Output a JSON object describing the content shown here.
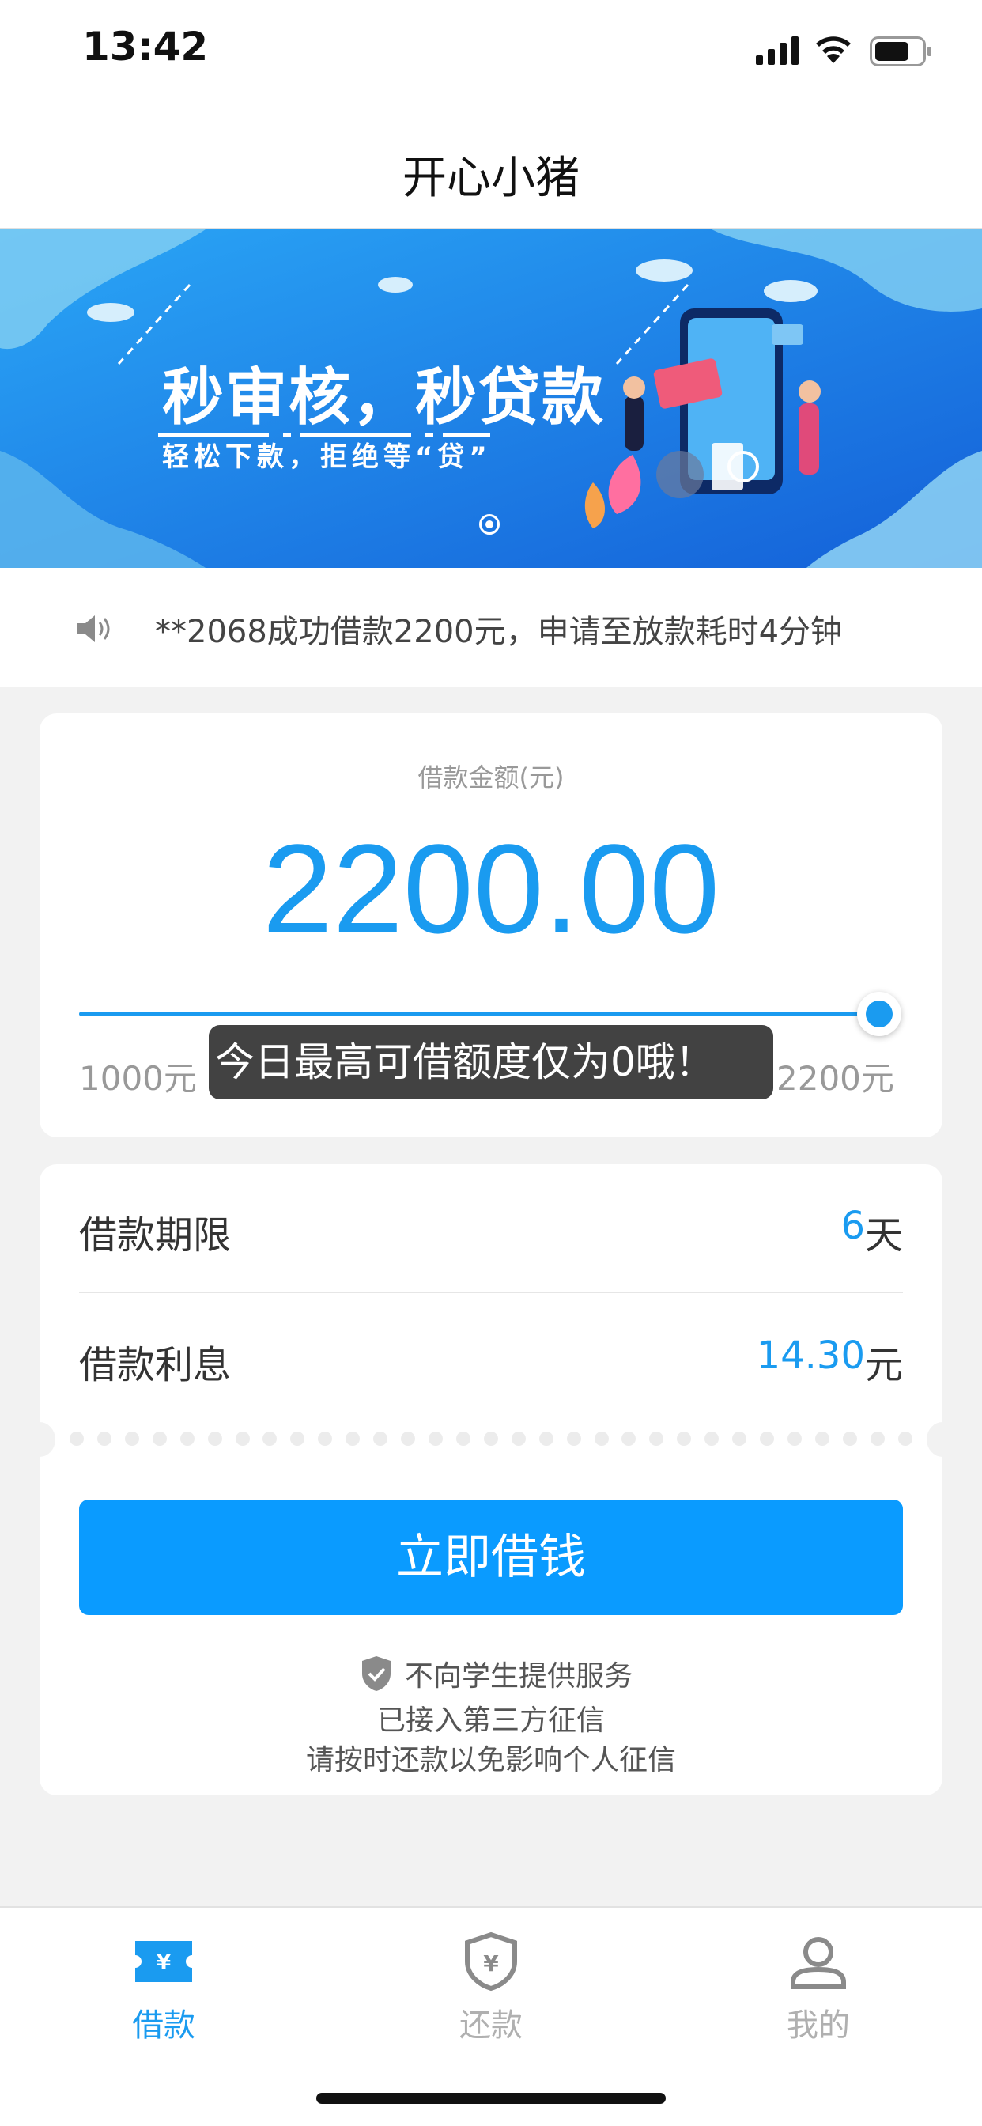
{
  "status_bar": {
    "time": "13:42",
    "icons": [
      "signal-icon",
      "wifi-icon",
      "battery-icon"
    ]
  },
  "nav": {
    "title": "开心小猪"
  },
  "banner": {
    "headline": "秒审核，秒贷款",
    "subline": "轻松下款，拒绝等“贷”",
    "page_indicator_count": 1,
    "background_color": "#1f8fee"
  },
  "notice": {
    "icon": "speaker-icon",
    "text": "**2068成功借款2200元，申请至放款耗时4分钟"
  },
  "amount_card": {
    "label": "借款金额(元)",
    "amount": "2200.00",
    "slider": {
      "min_label": "1000元",
      "max_label": "2200元",
      "fill_fraction": 1.0
    },
    "toast": "今日最高可借额度仅为0哦！"
  },
  "details": {
    "term": {
      "label": "借款期限",
      "value": "6",
      "unit": "天"
    },
    "interest": {
      "label": "借款利息",
      "value": "14.30",
      "unit": "元"
    },
    "button_label": "立即借钱",
    "disclaimer": {
      "icon": "shield-check-icon",
      "line1": "不向学生提供服务",
      "line2": "已接入第三方征信",
      "line3": "请按时还款以免影响个人征信"
    }
  },
  "tabbar": {
    "items": [
      {
        "label": "借款",
        "icon": "ticket-yen-icon",
        "active": true
      },
      {
        "label": "还款",
        "icon": "shield-yen-icon",
        "active": false
      },
      {
        "label": "我的",
        "icon": "person-icon",
        "active": false
      }
    ]
  },
  "colors": {
    "accent": "#1a9bf0",
    "button": "#0a9bff",
    "inactive_tab": "#b0b0b0"
  }
}
